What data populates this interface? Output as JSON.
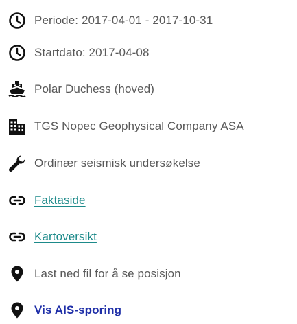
{
  "details": {
    "period": {
      "icon": "clock-icon",
      "text": "Periode: 2017-04-01 - 2017-10-31"
    },
    "start_date": {
      "icon": "clock-icon",
      "text": "Startdato: 2017-04-08"
    },
    "vessel": {
      "icon": "ship-icon",
      "text": "Polar Duchess (hoved)"
    },
    "company": {
      "icon": "building-icon",
      "text": "TGS Nopec Geophysical Company ASA"
    },
    "survey_type": {
      "icon": "wrench-icon",
      "text": "Ordinær seismisk undersøkelse"
    },
    "fact_page": {
      "icon": "link-icon",
      "text": "Faktaside"
    },
    "map_overview": {
      "icon": "link-icon",
      "text": "Kartoversikt"
    },
    "position_note": {
      "icon": "map-pin-icon",
      "text": "Last ned fil for å se posisjon"
    },
    "ais_tracking": {
      "icon": "map-pin-icon",
      "text": "Vis AIS-sporing"
    }
  },
  "colors": {
    "text": "#595959",
    "link": "#1d8a8a",
    "ais_link": "#1f2fa8",
    "icon": "#111111"
  }
}
